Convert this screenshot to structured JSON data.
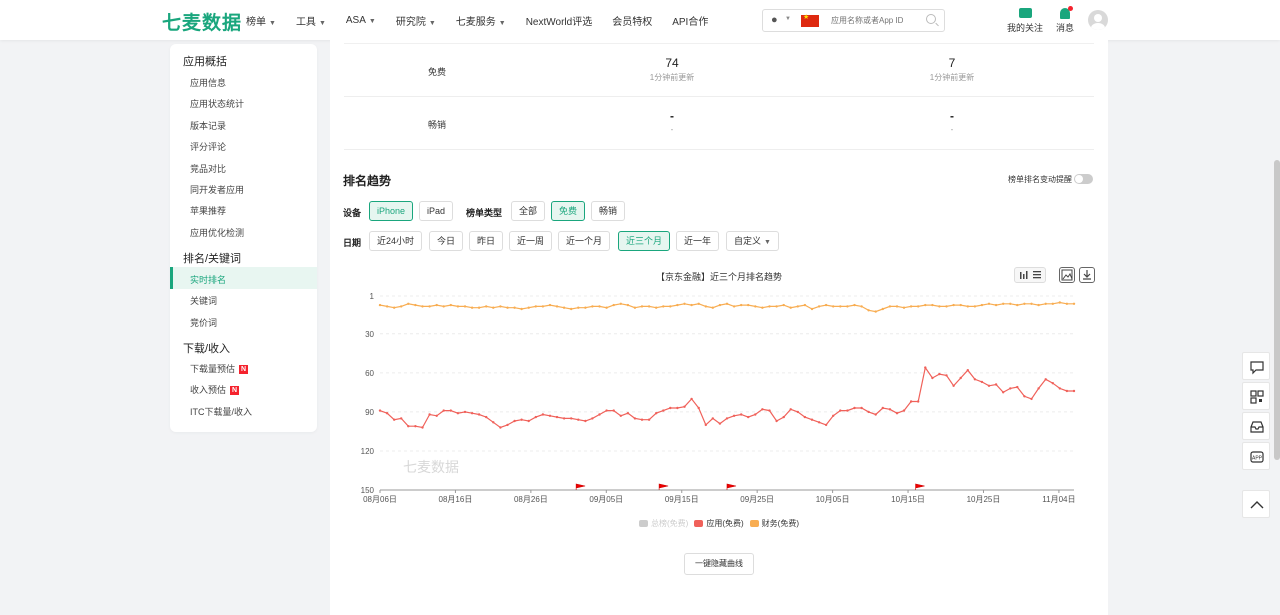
{
  "header": {
    "logo": "七麦数据",
    "nav": [
      {
        "label": "榜单",
        "caret": true
      },
      {
        "label": "工具",
        "caret": true
      },
      {
        "label": "ASA",
        "caret": true
      },
      {
        "label": "研究院",
        "caret": true
      },
      {
        "label": "七麦服务",
        "caret": true
      },
      {
        "label": "NextWorld评选",
        "caret": false
      },
      {
        "label": "会员特权",
        "caret": false
      },
      {
        "label": "API合作",
        "caret": false
      }
    ],
    "search_placeholder": "应用名称或者App ID",
    "favorites": "我的关注",
    "messages": "消息"
  },
  "sidebar": {
    "group1": "应用概括",
    "items1": [
      "应用信息",
      "应用状态统计",
      "版本记录",
      "评分评论",
      "竞品对比",
      "同开发者应用",
      "苹果推荐",
      "应用优化检测"
    ],
    "group2": "排名/关键词",
    "items2": [
      "实时排名",
      "关键词",
      "竞价词"
    ],
    "group3": "下载/收入",
    "items3": [
      "下载量预估",
      "收入预估",
      "ITC下载量/收入"
    ],
    "new_badge": "N"
  },
  "ranks": {
    "row1": {
      "label": "免费",
      "v1": "74",
      "s1": "1分钟前更新",
      "v2": "7",
      "s2": "1分钟前更新"
    },
    "row2": {
      "label": "畅销",
      "v1": "-",
      "s1": "-",
      "v2": "-",
      "s2": "-"
    }
  },
  "trend": {
    "title": "排名趋势",
    "alert_label": "榜单排名变动提醒",
    "device_label": "设备",
    "devices": [
      "iPhone",
      "iPad"
    ],
    "type_label": "榜单类型",
    "types": [
      "全部",
      "免费",
      "畅销"
    ],
    "date_label": "日期",
    "dates": [
      "近24小时",
      "今日",
      "昨日",
      "近一周",
      "近一个月",
      "近三个月",
      "近一年",
      "自定义"
    ],
    "hide_button": "一键隐藏曲线"
  },
  "chart_data": {
    "type": "line",
    "title": "【京东金融】近三个月排名趋势",
    "y_inverted": true,
    "ylim": [
      1,
      150
    ],
    "y_ticks": [
      1,
      30,
      60,
      90,
      120,
      150
    ],
    "x_ticks": [
      "08月06日",
      "08月16日",
      "08月26日",
      "09月05日",
      "09月15日",
      "09月25日",
      "10月05日",
      "10月15日",
      "10月25日",
      "11月04日"
    ],
    "x_range_days": 92,
    "watermark": "七麦数据",
    "legend": [
      {
        "name": "总榜(免费)",
        "color": "#cccccc",
        "active": false
      },
      {
        "name": "应用(免费)",
        "color": "#f0615a",
        "active": true
      },
      {
        "name": "财务(免费)",
        "color": "#f8ad52",
        "active": true
      }
    ],
    "series": [
      {
        "name": "应用(免费)",
        "color": "#f0615a",
        "values": [
          89,
          91,
          96,
          95,
          101,
          101,
          102,
          92,
          93,
          89,
          89,
          91,
          90,
          91,
          92,
          94,
          98,
          102,
          100,
          97,
          96,
          97,
          94,
          92,
          93,
          94,
          95,
          95,
          96,
          97,
          95,
          92,
          89,
          89,
          93,
          91,
          95,
          96,
          96,
          91,
          89,
          87,
          87,
          86,
          80,
          87,
          100,
          95,
          99,
          95,
          93,
          92,
          94,
          92,
          88,
          89,
          97,
          94,
          88,
          90,
          94,
          96,
          98,
          100,
          93,
          89,
          89,
          87,
          87,
          90,
          92,
          87,
          88,
          91,
          89,
          82,
          82,
          56,
          64,
          61,
          62,
          70,
          64,
          58,
          65,
          67,
          70,
          69,
          75,
          72,
          71,
          78,
          80,
          72,
          65,
          68,
          72,
          74,
          74
        ]
      },
      {
        "name": "财务(免费)",
        "color": "#f8ad52",
        "values": [
          8,
          9,
          10,
          9,
          7,
          8,
          9,
          9,
          8,
          9,
          8,
          9,
          9,
          10,
          10,
          9,
          10,
          9,
          10,
          10,
          11,
          10,
          9,
          9,
          8,
          9,
          10,
          11,
          10,
          10,
          9,
          9,
          10,
          8,
          7,
          8,
          10,
          9,
          9,
          10,
          9,
          9,
          8,
          7,
          8,
          7,
          9,
          10,
          8,
          7,
          9,
          8,
          8,
          9,
          10,
          9,
          9,
          8,
          10,
          9,
          8,
          11,
          9,
          8,
          9,
          9,
          9,
          8,
          9,
          12,
          13,
          11,
          9,
          9,
          10,
          9,
          9,
          8,
          8,
          9,
          9,
          8,
          8,
          9,
          9,
          8,
          7,
          8,
          7,
          7,
          8,
          7,
          7,
          8,
          7,
          7,
          6,
          7,
          7
        ]
      }
    ],
    "markers_day": [
      26,
      37,
      46,
      71
    ]
  }
}
